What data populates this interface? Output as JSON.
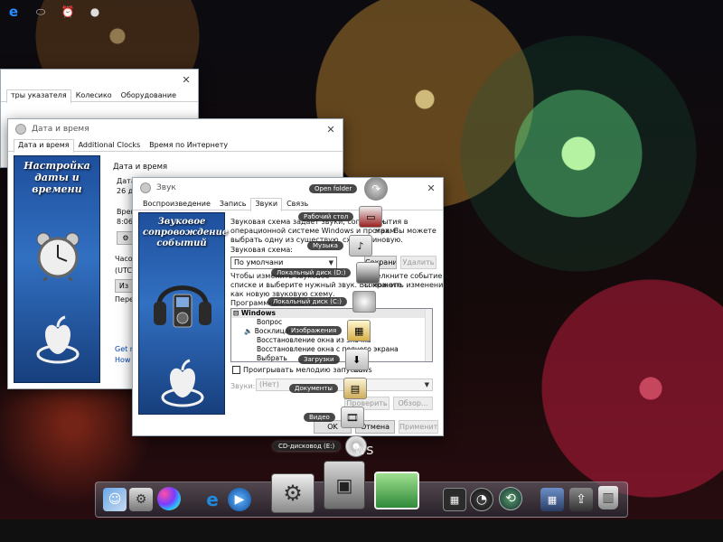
{
  "window_mouse": {
    "tabs": [
      "тры указателя",
      "Колесико",
      "Оборудование"
    ]
  },
  "window_datetime": {
    "title": "Дата и время",
    "tabs": [
      "Дата и время",
      "Additional Clocks",
      "Время по Интернету"
    ],
    "panel_title": "Настройка даты и времени",
    "section_label": "Дата и время",
    "date_partial": "Дата",
    "date_value": "26 д",
    "time_partial": "Врем",
    "time_value": "8:06",
    "timezone_label": "Часов",
    "timezone_value": "(UTC-",
    "change_partial": "Из",
    "transfer_partial": "Перек",
    "link1": "Get m",
    "link2": "How c"
  },
  "window_sound": {
    "title": "Звук",
    "tabs": [
      "Воспроизведение",
      "Запись",
      "Звуки",
      "Связь"
    ],
    "panel_title": "Звуковое сопровождение событий",
    "description": [
      "Звуковая схема задает звуки, сопровож",
      "события в",
      "операционной системе Windows и програм",
      "мах. Вы можете",
      "выбрать одну из существую",
      "схем или",
      "новую."
    ],
    "scheme_label": "Звуковая схема:",
    "scheme_value": "По умолчани",
    "save_as": "Сохранить как...",
    "delete": "Удалить",
    "events_text": [
      "Чтобы изменить звуковое",
      "щелкните событие в",
      "списке и выберите нужный звук. Вы можете",
      "сохранить изменения",
      "как новую звуковую схему."
    ],
    "program_events_label": "Программные события:",
    "events": [
      "Windows",
      "Вопрос",
      "Восклицание",
      "Восстановление окна из значка",
      "Восстановление окна с полного экрана",
      "Выбрать"
    ],
    "startup_checkbox": "Проигрывать мелодию запуска",
    "startup_checkbox_tail": "dows",
    "sounds_label": "Звуки:",
    "sounds_value": "(Нет)",
    "test": "Проверить",
    "browse": "Обзор...",
    "ok": "OK",
    "cancel": "Отмена",
    "apply": "Применить"
  },
  "stack": {
    "open_folder": "Open folder",
    "items": [
      "Рабочий стол",
      "Музыка",
      "Локальный диск (D:)",
      "Локальный диск (C:)",
      "Изображения",
      "Загрузки",
      "Документы",
      "Видео",
      "CD-дисковод (E:)"
    ]
  },
  "desktop_text": "ws",
  "icons": {
    "open_folder": "arrow-circle-icon",
    "dock": [
      "finder-icon",
      "settings-icon",
      "color-balls-icon",
      "ie-icon",
      "quicktime-icon",
      "system-preferences-icon",
      "hard-drive-icon",
      "photos-icon",
      "dashboard-icon",
      "speedometer-icon",
      "time-machine-icon",
      "spaces-icon",
      "share-icon",
      "trash-icon"
    ],
    "taskbar": [
      "edge-icon",
      "toolbar-icon",
      "alarm-icon",
      "apple-icon"
    ]
  }
}
